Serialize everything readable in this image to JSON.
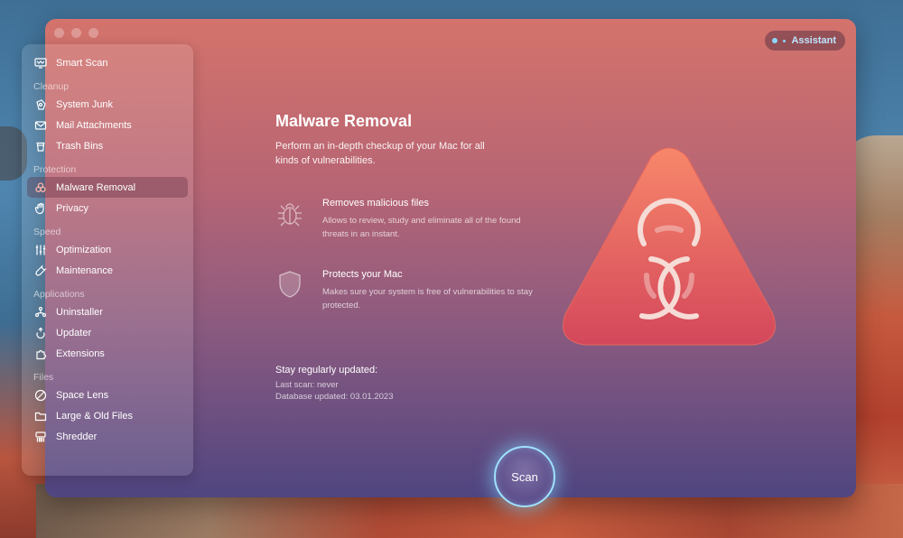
{
  "window": {
    "assistant_label": "Assistant"
  },
  "sidebar": {
    "smart_scan": "Smart Scan",
    "sections": {
      "cleanup": "Cleanup",
      "protection": "Protection",
      "speed": "Speed",
      "applications": "Applications",
      "files": "Files"
    },
    "items": {
      "system_junk": "System Junk",
      "mail_attachments": "Mail Attachments",
      "trash_bins": "Trash Bins",
      "malware_removal": "Malware Removal",
      "privacy": "Privacy",
      "optimization": "Optimization",
      "maintenance": "Maintenance",
      "uninstaller": "Uninstaller",
      "updater": "Updater",
      "extensions": "Extensions",
      "space_lens": "Space Lens",
      "large_old_files": "Large & Old Files",
      "shredder": "Shredder"
    },
    "active_item": "malware_removal"
  },
  "main": {
    "title": "Malware Removal",
    "subtitle": "Perform an in-depth checkup of your Mac for all kinds of vulnerabilities.",
    "features": [
      {
        "icon": "bug-icon",
        "title": "Removes malicious files",
        "description": "Allows to review, study and eliminate all of the found threats in an instant."
      },
      {
        "icon": "shield-icon",
        "title": "Protects your Mac",
        "description": "Makes sure your system is free of vulnerabilities to stay protected."
      }
    ],
    "status": {
      "heading": "Stay regularly updated:",
      "last_scan": "Last scan: never",
      "database_updated": "Database updated: 03.01.2023"
    },
    "scan_button": "Scan"
  },
  "colors": {
    "accent_glow": "#9fe3ff",
    "emblem_top": "#f5876a",
    "emblem_bottom": "#d5455a"
  }
}
